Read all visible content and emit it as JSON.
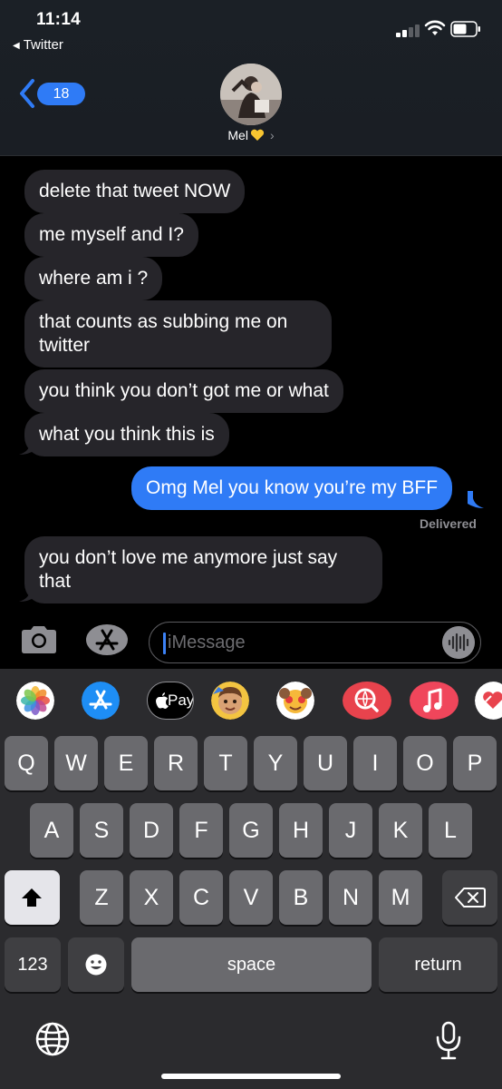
{
  "status": {
    "time": "11:14",
    "back_app": "Twitter"
  },
  "nav": {
    "unread_count": "18",
    "contact_name": "Mel"
  },
  "messages": [
    {
      "text": "delete that tweet NOW",
      "direction": "incoming"
    },
    {
      "text": "me myself and I?",
      "direction": "incoming"
    },
    {
      "text": "where am i ?",
      "direction": "incoming"
    },
    {
      "text": "that counts as subbing me on twitter",
      "direction": "incoming"
    },
    {
      "text": "you think you don’t got me or what",
      "direction": "incoming"
    },
    {
      "text": "what you think this is",
      "direction": "incoming"
    },
    {
      "text": "Omg Mel you know you’re my BFF",
      "direction": "outgoing"
    },
    {
      "text": "you don’t love me anymore just say that",
      "direction": "incoming"
    }
  ],
  "delivered_label": "Delivered",
  "input": {
    "placeholder": "iMessage"
  },
  "app_strip": {
    "items": [
      "photos-icon",
      "app-store-icon",
      "apple-pay-icon",
      "memoji-icon",
      "animoji-icon",
      "web-search-icon",
      "music-icon",
      "digital-touch-icon"
    ],
    "pay_label": "Pay"
  },
  "keyboard": {
    "row1": [
      "Q",
      "W",
      "E",
      "R",
      "T",
      "Y",
      "U",
      "I",
      "O",
      "P"
    ],
    "row2": [
      "A",
      "S",
      "D",
      "F",
      "G",
      "H",
      "J",
      "K",
      "L"
    ],
    "row3": [
      "Z",
      "X",
      "C",
      "V",
      "B",
      "N",
      "M"
    ],
    "numbers_label": "123",
    "space_label": "space",
    "return_label": "return"
  },
  "colors": {
    "accent": "#2f7bf6",
    "incoming_bubble": "#26252a",
    "keyboard_bg": "#2b2b2e",
    "key_bg": "#6a6a6e"
  }
}
